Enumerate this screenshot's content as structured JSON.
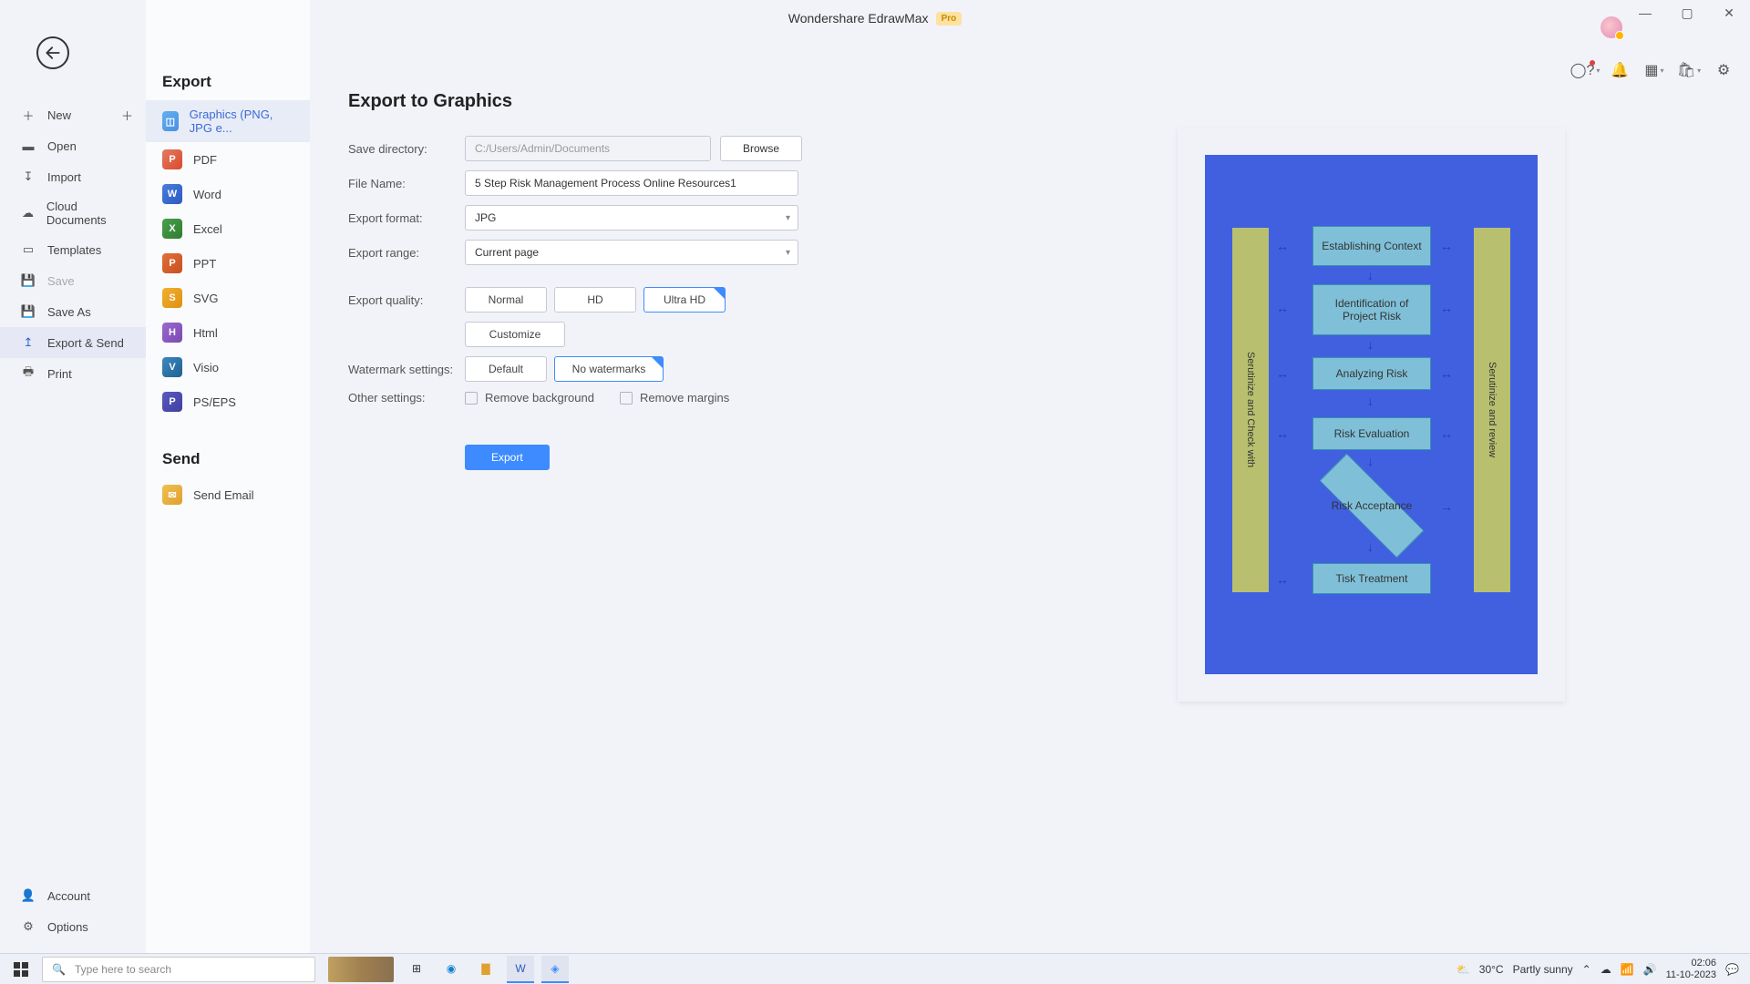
{
  "app": {
    "title": "Wondershare EdrawMax",
    "badge": "Pro"
  },
  "sidebar1": {
    "new": "New",
    "open": "Open",
    "import": "Import",
    "cloud": "Cloud Documents",
    "templates": "Templates",
    "save": "Save",
    "saveas": "Save As",
    "exportsend": "Export & Send",
    "print": "Print",
    "account": "Account",
    "options": "Options"
  },
  "sidebar2": {
    "export_title": "Export",
    "graphics": "Graphics (PNG, JPG e...",
    "pdf": "PDF",
    "word": "Word",
    "excel": "Excel",
    "ppt": "PPT",
    "svg": "SVG",
    "html": "Html",
    "visio": "Visio",
    "ps": "PS/EPS",
    "send_title": "Send",
    "email": "Send Email"
  },
  "main": {
    "title": "Export to Graphics",
    "labels": {
      "savedir": "Save directory:",
      "filename": "File Name:",
      "format": "Export format:",
      "range": "Export range:",
      "quality": "Export quality:",
      "watermark": "Watermark settings:",
      "other": "Other settings:"
    },
    "savedir_value": "C:/Users/Admin/Documents",
    "browse": "Browse",
    "filename_value": "5 Step Risk Management Process Online Resources1",
    "format_value": "JPG",
    "range_value": "Current page",
    "quality": {
      "normal": "Normal",
      "hd": "HD",
      "uhd": "Ultra HD",
      "customize": "Customize"
    },
    "watermark": {
      "default": "Default",
      "none": "No watermarks"
    },
    "other": {
      "remove_bg": "Remove background",
      "remove_margins": "Remove margins"
    },
    "export_btn": "Export"
  },
  "preview": {
    "left_side": "Serutinize and Check with",
    "right_side": "Serutinize and review",
    "boxes": {
      "b1": "Establishing Context",
      "b2": "Identification of Project Risk",
      "b3": "Analyzing Risk",
      "b4": "Risk Evaluation",
      "b5": "Risk Acceptance",
      "b6": "Tisk Treatment"
    }
  },
  "taskbar": {
    "search_placeholder": "Type here to search",
    "weather_temp": "30°C",
    "weather_desc": "Partly sunny",
    "time": "02:06",
    "date": "11-10-2023"
  }
}
